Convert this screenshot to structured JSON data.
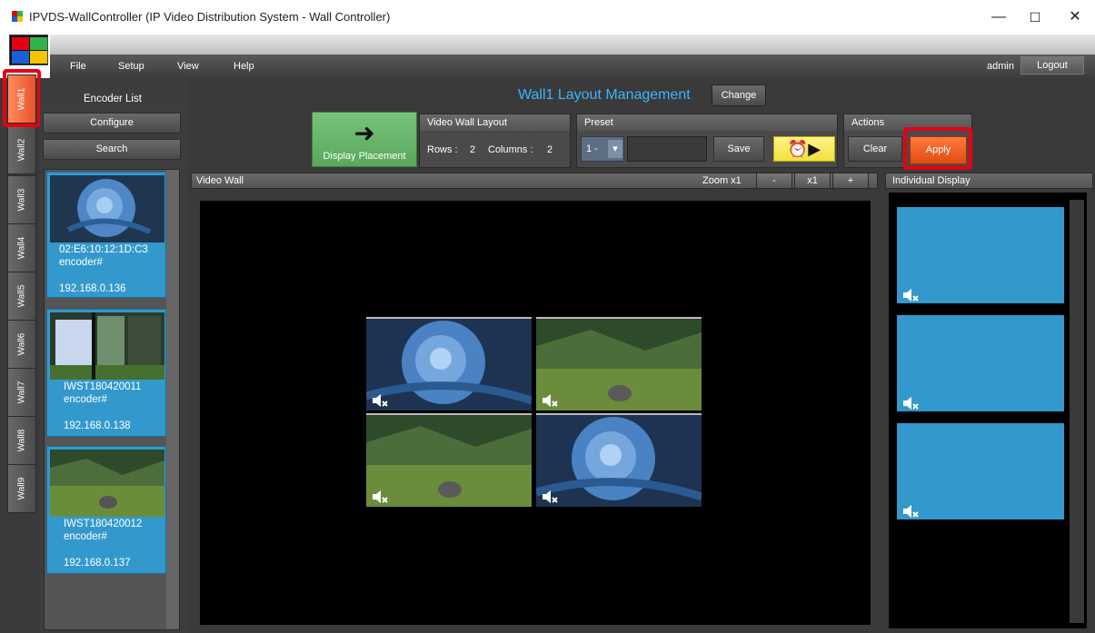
{
  "window": {
    "title": "IPVDS-WallController (IP Video Distribution System - Wall Controller)",
    "controls": [
      "—",
      "☐",
      "✕"
    ]
  },
  "menu": {
    "items": [
      "File",
      "Setup",
      "View",
      "Help"
    ],
    "user": "admin",
    "logout": "Logout"
  },
  "walls": [
    "Wall1",
    "Wall2",
    "Wall3",
    "Wall4",
    "Wall5",
    "Wall6",
    "Wall7",
    "Wall8",
    "Wall9"
  ],
  "encoder_panel": {
    "title": "Encoder List",
    "configure": "Configure",
    "search": "Search",
    "encoders": [
      {
        "id": "02:E6:10:12:1D:C3",
        "name": "encoder#",
        "ip": "192.168.0.136",
        "scene": "rose"
      },
      {
        "id": "IWST180420011",
        "name": "encoder#",
        "ip": "192.168.0.138",
        "scene": "window"
      },
      {
        "id": "IWST180420012",
        "name": "encoder#",
        "ip": "192.168.0.137",
        "scene": "forest"
      }
    ]
  },
  "layout_mgmt": {
    "title": "Wall1 Layout Management",
    "change": "Change",
    "display_placement": "Display Placement",
    "video_wall_layout": {
      "header": "Video Wall Layout",
      "rows_label": "Rows :",
      "rows": "2",
      "cols_label": "Columns :",
      "cols": "2"
    },
    "preset": {
      "header": "Preset",
      "selected": "1 -",
      "name_value": "",
      "save": "Save"
    },
    "actions": {
      "header": "Actions",
      "clear": "Clear",
      "apply": "Apply"
    }
  },
  "video_wall": {
    "header": "Video Wall",
    "zoom_label": "Zoom x1",
    "zoom_minus": "-",
    "zoom_reset": "x1",
    "zoom_plus": "+",
    "tiles": [
      "rose",
      "forest",
      "forest",
      "rose"
    ]
  },
  "individual_display": {
    "header": "Individual Display",
    "count": 3
  },
  "colors": {
    "accent_blue": "#3db3ff",
    "tile_blue": "#3399cc",
    "apply_orange": "#e24b16",
    "highlight_red": "#e60012"
  }
}
